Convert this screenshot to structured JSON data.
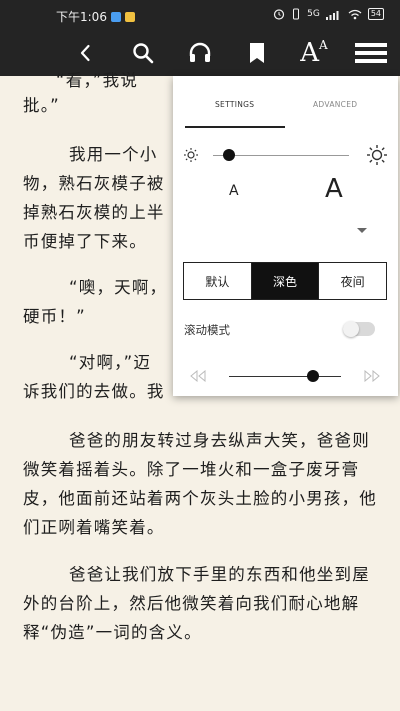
{
  "status_bar": {
    "time": "下午1:06",
    "signal": "5G",
    "battery": "54"
  },
  "toolbar": {
    "back_icon": "chevron-left-icon",
    "search_icon": "search-icon",
    "audio_icon": "headphones-icon",
    "bookmark_icon": "bookmark-icon",
    "font_size_icon": "font-size-icon",
    "menu_icon": "hamburger-menu-icon",
    "font_size_big": "A",
    "font_size_small": "A"
  },
  "book": {
    "paragraphs": [
      "“看，”我说",
      "批。”",
      "我用一个小",
      "物，熟石灰模子被",
      "掉熟石灰模的上半",
      "币便掉了下来。",
      "“噢，天啊，",
      "硬币！”",
      "“对啊，”迈",
      "诉我们的去做。我",
      "爸爸的朋友转过身去纵声大笑，爸爸则微笑着摇着头。除了一堆火和一盒子废牙膏皮，他面前还站着两个灰头土脸的小男孩，他们正咧着嘴笑着。",
      "爸爸让我们放下手里的东西和他坐到屋外的台阶上，然后他微笑着向我们耐心地解释“伪造”一词的含义。"
    ]
  },
  "settings_panel": {
    "tabs": [
      {
        "label": "SETTINGS",
        "active": true
      },
      {
        "label": "ADVANCED",
        "active": false
      }
    ],
    "brightness": 0.12,
    "font_small_label": "A",
    "font_large_label": "A",
    "themes": [
      {
        "label": "默认",
        "active": false
      },
      {
        "label": "深色",
        "active": true
      },
      {
        "label": "夜间",
        "active": false
      }
    ],
    "scroll_mode_label": "滚动模式",
    "scroll_mode_on": false,
    "progress": 0.75
  },
  "colors": {
    "toolbar_bg": "#242424",
    "page_bg": "#f6f1e6",
    "text": "#1e1e1e",
    "panel_bg": "#ffffff",
    "accent": "#111111"
  }
}
